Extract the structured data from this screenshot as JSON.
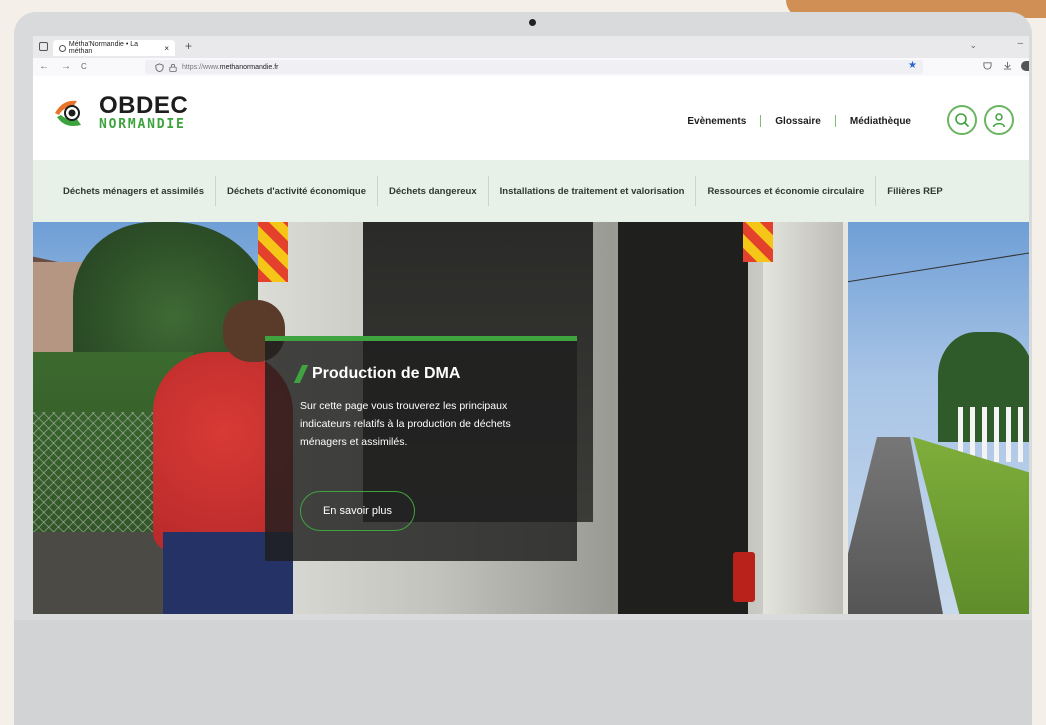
{
  "browser": {
    "tab_title": "Métha'Normandie • La méthan",
    "tab_close": "×",
    "new_tab": "+",
    "tab_menu": "⌄",
    "minimize": "–",
    "back": "←",
    "forward": "→",
    "reload": "C",
    "url_prefix": "https://www.",
    "url_domain": "methanormandie.fr",
    "bookmark_icon": "star-icon",
    "colors": {
      "bookmark": "#2a63d4"
    }
  },
  "site": {
    "logo_line1": "OBDEC",
    "logo_line2": "NORMANDIE",
    "top_links": [
      "Evènements",
      "Glossaire",
      "Médiathèque"
    ],
    "nav_items": [
      "Déchets ménagers et assimilés",
      "Déchets d'activité économique",
      "Déchets dangereux",
      "Installations de traitement et valorisation",
      "Ressources et économie circulaire",
      "Filières REP"
    ],
    "colors": {
      "accent_green": "#3fa33f",
      "nav_bg": "#e7f1e7"
    }
  },
  "hero": {
    "title": "Production de DMA",
    "text": "Sur cette page vous trouverez les principaux indicateurs relatifs à la production de déchets ménagers et assimilés.",
    "button": "En savoir plus"
  }
}
